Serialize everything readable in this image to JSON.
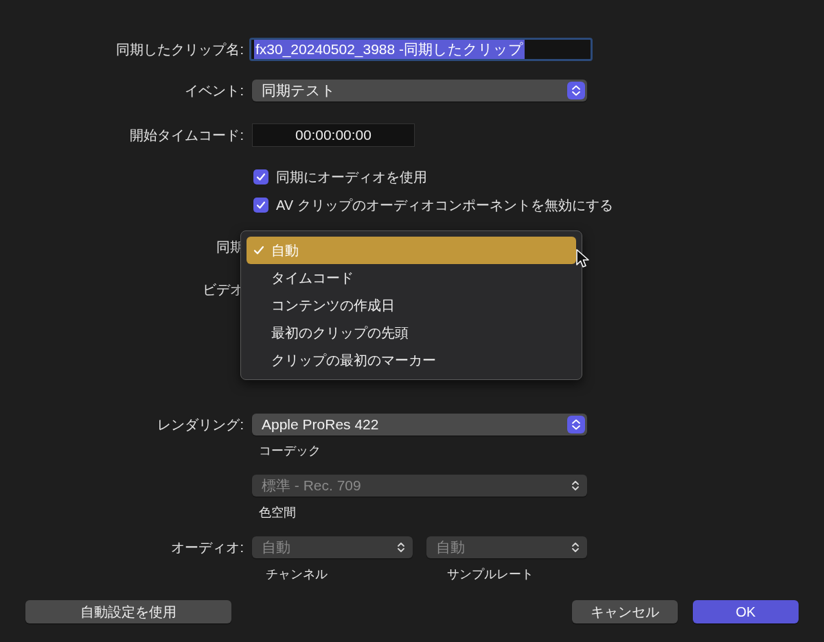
{
  "name_field": {
    "label": "同期したクリップ名:",
    "value": "fx30_20240502_3988 -同期したクリップ",
    "selected": true
  },
  "event": {
    "label": "イベント:",
    "value": "同期テスト",
    "disabled": false
  },
  "start_timecode": {
    "label": "開始タイムコード:",
    "value": "00:00:00:00"
  },
  "checkboxes": [
    {
      "label": "同期にオーディオを使用",
      "checked": true
    },
    {
      "label": "AV クリップのオーディオコンポーネントを無効にする",
      "checked": true
    }
  ],
  "sync": {
    "label": "同期",
    "menu": [
      {
        "label": "自動",
        "selected": true
      },
      {
        "label": "タイムコード",
        "selected": false
      },
      {
        "label": "コンテンツの作成日",
        "selected": false
      },
      {
        "label": "最初のクリップの先頭",
        "selected": false
      },
      {
        "label": "クリップの最初のマーカー",
        "selected": false
      }
    ]
  },
  "video": {
    "label": "ビデオ"
  },
  "rendering": {
    "label": "レンダリング:",
    "codec": {
      "value": "Apple ProRes 422",
      "caption": "コーデック",
      "disabled": false
    },
    "color_space": {
      "value": "標準 - Rec. 709",
      "caption": "色空間",
      "disabled": true
    }
  },
  "audio": {
    "label": "オーディオ:",
    "popups": [
      {
        "value": "自動",
        "caption": "チャンネル",
        "disabled": true
      },
      {
        "value": "自動",
        "caption": "サンプルレート",
        "disabled": true
      }
    ]
  },
  "buttons": [
    {
      "label": "自動設定を使用",
      "kind": "secondary"
    },
    {
      "label": "キャンセル",
      "kind": "secondary"
    },
    {
      "label": "OK",
      "kind": "default"
    }
  ]
}
